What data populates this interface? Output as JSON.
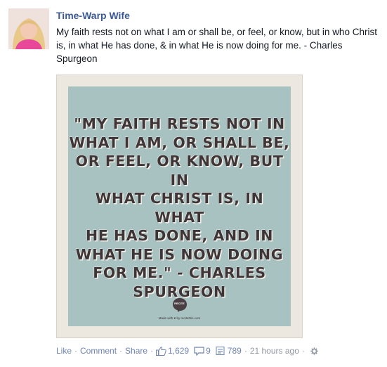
{
  "post": {
    "author": "Time-Warp Wife",
    "text": "My faith rests not on what I am or shall be, or feel, or know, but in who Christ is, in what He has done, & in what He is now doing for me. - Charles Spurgeon",
    "image": {
      "quote_lines": [
        "\"MY FAITH RESTS NOT IN",
        "WHAT I AM, OR SHALL BE,",
        "OR FEEL, OR KNOW, BUT IN",
        "WHAT CHRIST IS, IN WHAT",
        "HE HAS DONE, AND IN",
        "WHAT HE IS NOW DOING",
        "FOR ME.\" - CHARLES",
        "SPURGEON"
      ],
      "badge": "RECITE",
      "made_with": "Made with ♥ by recitethis.com"
    },
    "actions": {
      "like": "Like",
      "comment": "Comment",
      "share": "Share",
      "like_count": "1,629",
      "comment_count": "9",
      "share_count": "789",
      "time": "21 hours ago",
      "separator": "·"
    }
  },
  "icons": [
    "thumbs-up-icon",
    "comment-icon",
    "share-icon",
    "gear-icon"
  ],
  "colors": {
    "link": "#3b5998",
    "action": "#6d84b4",
    "muted": "#9197a3",
    "image_bg": "#a8c2c1"
  }
}
